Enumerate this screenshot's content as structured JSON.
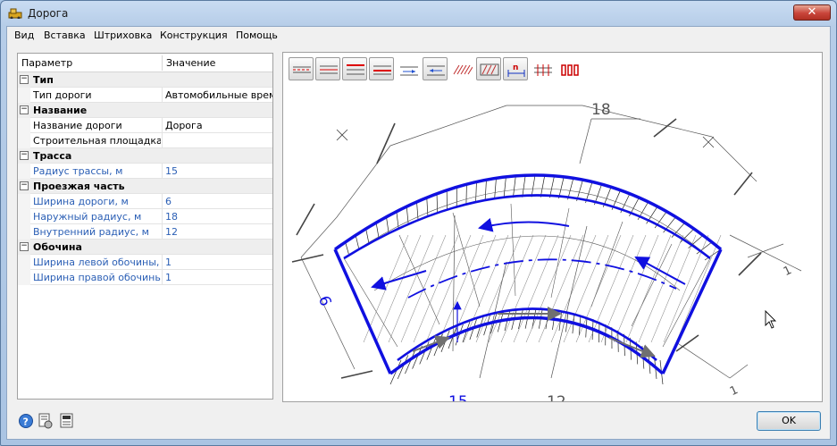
{
  "window": {
    "title": "Дорога",
    "close_label": "✕"
  },
  "menu": [
    "Вид",
    "Вставка",
    "Штриховка",
    "Конструкция",
    "Помощь"
  ],
  "properties": {
    "header": {
      "param": "Параметр",
      "value": "Значение"
    },
    "rows": [
      {
        "type": "section",
        "label": "Тип"
      },
      {
        "type": "prop",
        "name": "Тип дороги",
        "value": "Автомобильные врем...",
        "blue": false
      },
      {
        "type": "section",
        "label": "Название"
      },
      {
        "type": "prop",
        "name": "Название дороги",
        "value": "Дорога",
        "blue": false
      },
      {
        "type": "prop",
        "name": "Строительная площадка",
        "value": "",
        "blue": false
      },
      {
        "type": "section",
        "label": "Трасса"
      },
      {
        "type": "prop",
        "name": "Радиус трассы, м",
        "value": "15",
        "blue": true
      },
      {
        "type": "section",
        "label": "Проезжая часть"
      },
      {
        "type": "prop",
        "name": "Ширина дороги, м",
        "value": "6",
        "blue": true
      },
      {
        "type": "prop",
        "name": "Наружный радиус, м",
        "value": "18",
        "blue": true
      },
      {
        "type": "prop",
        "name": "Внутренний радиус, м",
        "value": "12",
        "blue": true
      },
      {
        "type": "section",
        "label": "Обочина"
      },
      {
        "type": "prop",
        "name": "Ширина левой обочины, м",
        "value": "1",
        "blue": true
      },
      {
        "type": "prop",
        "name": "Ширина правой обочины, м",
        "value": "1",
        "blue": true
      }
    ]
  },
  "toolbar": [
    {
      "icon": "two-lane-red-icon",
      "pressed": true
    },
    {
      "icon": "three-line-red-icon",
      "pressed": true
    },
    {
      "icon": "red-top-line-icon",
      "pressed": true
    },
    {
      "icon": "red-center-line-icon",
      "pressed": true
    },
    {
      "icon": "arrow-right-lane-icon",
      "pressed": false
    },
    {
      "icon": "arrow-left-lane-icon",
      "pressed": true
    },
    {
      "icon": "hatch-icon",
      "pressed": false
    },
    {
      "icon": "hatch-bordered-icon",
      "pressed": true
    },
    {
      "icon": "dimension-n-icon",
      "pressed": true
    },
    {
      "icon": "dimension-ticks-icon",
      "pressed": false
    },
    {
      "icon": "red-bars-icon",
      "pressed": false
    }
  ],
  "drawing": {
    "dim_outer": "18",
    "dim_width": "6",
    "dim_route": "15",
    "dim_inner": "12",
    "dim_side": "1"
  },
  "footer": {
    "ok_label": "OK",
    "icons": [
      "help-icon",
      "settings-icon",
      "text-icon"
    ]
  },
  "colors": {
    "accent": "#1010e0",
    "section_bg": "#eeeeee"
  }
}
